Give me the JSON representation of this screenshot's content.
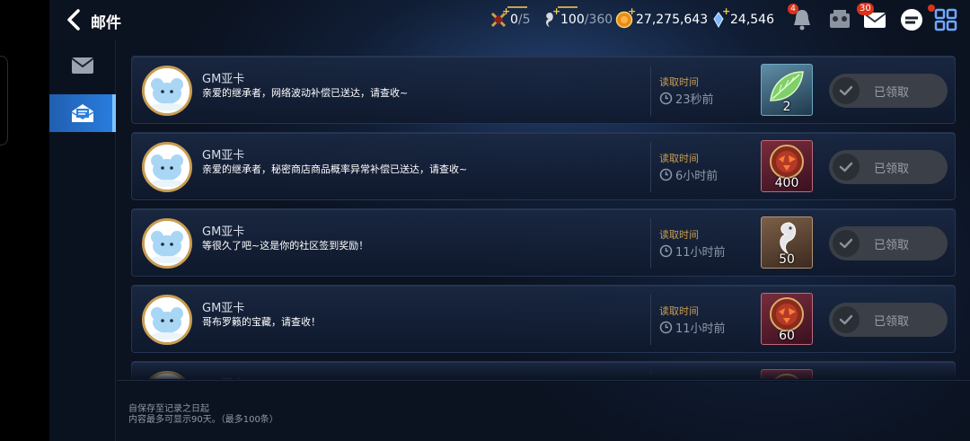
{
  "header": {
    "title": "邮件",
    "resources": {
      "stamina": {
        "current": "0",
        "max": "/5"
      },
      "energy": {
        "current": "100",
        "max": "/360"
      },
      "gold": "27,275,643",
      "crystal": "24,546"
    },
    "notification_badge": "4",
    "mail_badge": "30"
  },
  "sidebar": {
    "tabs": [
      {
        "name": "inbox",
        "active": false
      },
      {
        "name": "read-mail",
        "active": true
      }
    ]
  },
  "read_label": "读取时间",
  "claimed_label": "已领取",
  "mails": [
    {
      "sender": "GM亚卡",
      "message": "亲爱的继承者，网络波动补偿已送达，请查收~",
      "time": "23秒前",
      "item": "green-leaf",
      "qty": "2"
    },
    {
      "sender": "GM亚卡",
      "message": "亲爱的继承者，秘密商店商品概率异常补偿已送达，请查收~",
      "time": "6小时前",
      "item": "red-medallion",
      "qty": "400"
    },
    {
      "sender": "GM亚卡",
      "message": "等很久了吧~这是你的社区签到奖励！",
      "time": "11小时前",
      "item": "silver-seahorse",
      "qty": "50"
    },
    {
      "sender": "GM亚卡",
      "message": "哥布罗籁的宝藏，请查收！",
      "time": "11小时前",
      "item": "red-medallion",
      "qty": "60"
    },
    {
      "sender": "GM亚卡",
      "message": "",
      "time": "",
      "item": "red-medallion",
      "qty": ""
    }
  ],
  "footer": {
    "line1": "自保存至记录之日起",
    "line2": "内容最多可显示90天。（最多100条）"
  },
  "colors": {
    "accent": "#2a7ee0",
    "gold": "#c99d52",
    "panel": "#1a2842"
  }
}
